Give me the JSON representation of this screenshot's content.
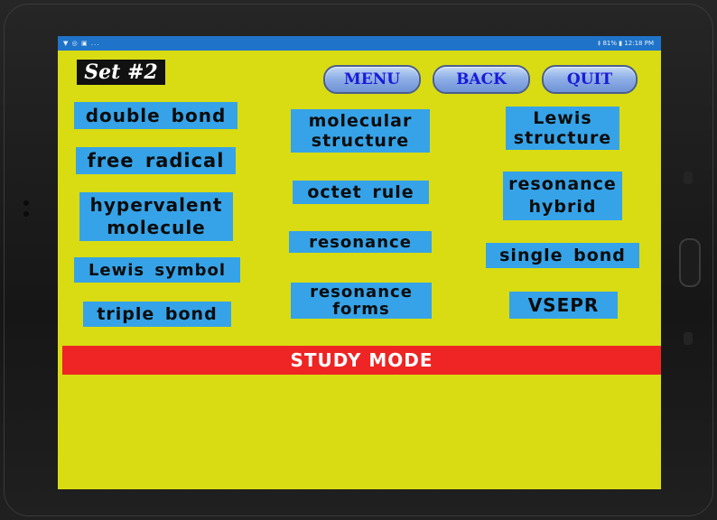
{
  "status_bar": {
    "left_icons": "▼ ◎ ▣ ...",
    "right_text": "‡ 81% ▮ 12:18 PM"
  },
  "set_label": "Set #2",
  "nav": {
    "menu": "MENU",
    "back": "BACK",
    "quit": "QUIT"
  },
  "terms": [
    "double bond",
    "molecular\nstructure",
    "Lewis\nstructure",
    "free radical",
    "hypervalent\nmolecule",
    "octet rule",
    "resonance\nhybrid",
    "resonance",
    "Lewis symbol",
    "single bond",
    "resonance\nforms",
    "triple bond",
    "VSEPR"
  ],
  "mode_banner": "STUDY MODE",
  "colors": {
    "screen_bg": "#d9dc12",
    "term_bg": "#36a3e8",
    "banner_bg": "#ef2424",
    "status_bar": "#1f74c9",
    "nav_text": "#1a1ad8"
  }
}
